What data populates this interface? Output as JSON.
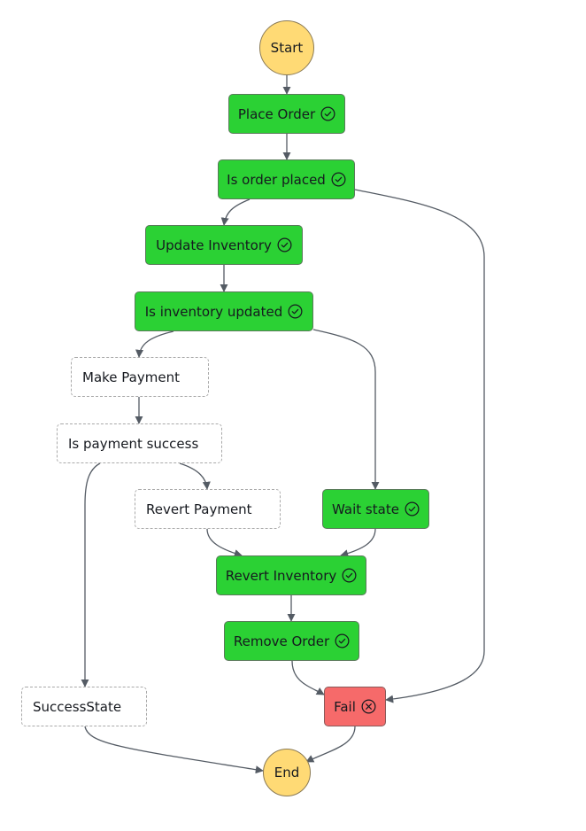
{
  "diagram": {
    "type": "state-machine-graph",
    "colors": {
      "succeeded": "#2bd134",
      "failed": "#f66a6a",
      "not_run": "#ffffff",
      "terminal": "#ffda75",
      "edge": "#545b64"
    },
    "nodes": [
      {
        "id": "start",
        "label": "Start",
        "status": "terminal"
      },
      {
        "id": "place-order",
        "label": "Place Order",
        "status": "succeeded",
        "icon": "check-circle-icon"
      },
      {
        "id": "is-order-placed",
        "label": "Is order placed",
        "status": "succeeded",
        "icon": "check-circle-icon"
      },
      {
        "id": "update-inventory",
        "label": "Update Inventory",
        "status": "succeeded",
        "icon": "check-circle-icon"
      },
      {
        "id": "is-inventory-updated",
        "label": "Is inventory updated",
        "status": "succeeded",
        "icon": "check-circle-icon"
      },
      {
        "id": "make-payment",
        "label": "Make Payment",
        "status": "not-run"
      },
      {
        "id": "is-payment-success",
        "label": "Is payment success",
        "status": "not-run"
      },
      {
        "id": "revert-payment",
        "label": "Revert Payment",
        "status": "not-run"
      },
      {
        "id": "wait-state",
        "label": "Wait state",
        "status": "succeeded",
        "icon": "check-circle-icon"
      },
      {
        "id": "revert-inventory",
        "label": "Revert Inventory",
        "status": "succeeded",
        "icon": "check-circle-icon"
      },
      {
        "id": "remove-order",
        "label": "Remove Order",
        "status": "succeeded",
        "icon": "check-circle-icon"
      },
      {
        "id": "success-state",
        "label": "SuccessState",
        "status": "not-run"
      },
      {
        "id": "fail",
        "label": "Fail",
        "status": "failed",
        "icon": "x-circle-icon"
      },
      {
        "id": "end",
        "label": "End",
        "status": "terminal"
      }
    ],
    "edges": [
      {
        "from": "start",
        "to": "place-order"
      },
      {
        "from": "place-order",
        "to": "is-order-placed"
      },
      {
        "from": "is-order-placed",
        "to": "update-inventory"
      },
      {
        "from": "is-order-placed",
        "to": "fail"
      },
      {
        "from": "update-inventory",
        "to": "is-inventory-updated"
      },
      {
        "from": "is-inventory-updated",
        "to": "make-payment"
      },
      {
        "from": "is-inventory-updated",
        "to": "wait-state"
      },
      {
        "from": "make-payment",
        "to": "is-payment-success"
      },
      {
        "from": "is-payment-success",
        "to": "success-state"
      },
      {
        "from": "is-payment-success",
        "to": "revert-payment"
      },
      {
        "from": "revert-payment",
        "to": "revert-inventory"
      },
      {
        "from": "wait-state",
        "to": "revert-inventory"
      },
      {
        "from": "revert-inventory",
        "to": "remove-order"
      },
      {
        "from": "remove-order",
        "to": "fail"
      },
      {
        "from": "success-state",
        "to": "end"
      },
      {
        "from": "fail",
        "to": "end"
      }
    ]
  }
}
